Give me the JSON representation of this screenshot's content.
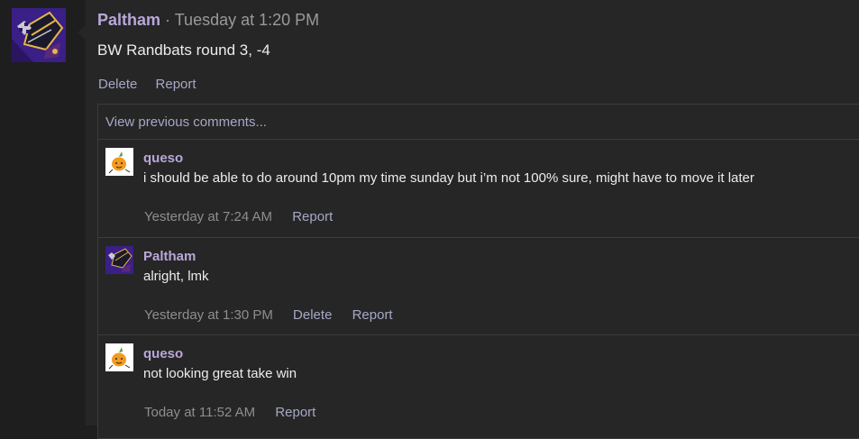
{
  "post": {
    "author": "Paltham",
    "separator": "·",
    "time": "Tuesday at 1:20 PM",
    "text": "BW Randbats round 3, -4",
    "actions": {
      "delete": "Delete",
      "report": "Report"
    }
  },
  "comments_section": {
    "view_previous": "View previous comments...",
    "comments": [
      {
        "author": "queso",
        "text": "i should be able to do around 10pm my time sunday but i’m not 100% sure, might have to move it later",
        "time": "Yesterday at 7:24 AM",
        "actions": {
          "report": "Report"
        }
      },
      {
        "author": "Paltham",
        "text": "alright, lmk",
        "time": "Yesterday at 1:30 PM",
        "actions": {
          "delete": "Delete",
          "report": "Report"
        }
      },
      {
        "author": "queso",
        "text": "not looking great take win",
        "time": "Today at 11:52 AM",
        "actions": {
          "report": "Report"
        }
      }
    ]
  },
  "colors": {
    "background": "#1e1e1e",
    "panel": "#262626",
    "author": "#b9a7d9",
    "link": "#a6a8c6",
    "muted": "#8e8e8e",
    "border": "#3c3c3c"
  }
}
